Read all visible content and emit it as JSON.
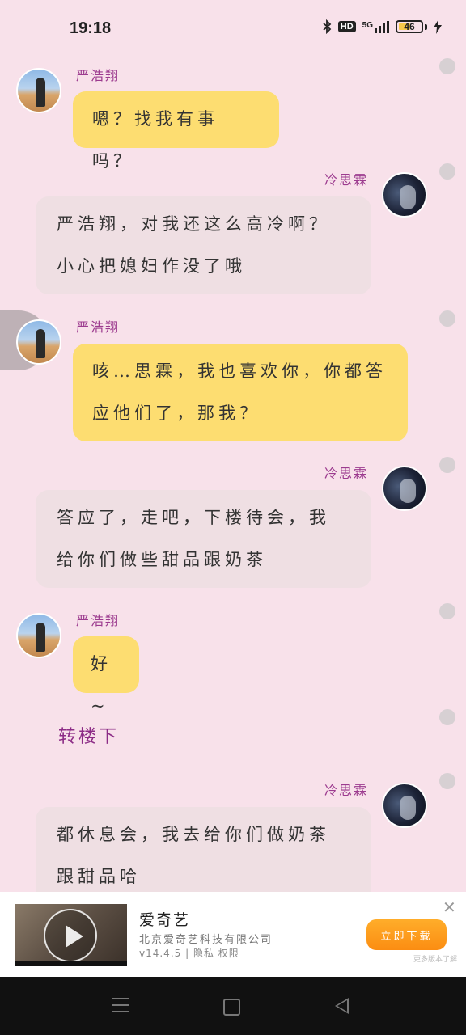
{
  "status_bar": {
    "time": "19:18",
    "hd_label": "HD",
    "network_label": "5G",
    "battery_level": "46"
  },
  "messages": [
    {
      "speaker": "严浩翔",
      "text": "嗯？找我有事吗？"
    },
    {
      "speaker": "冷思霖",
      "text": "严浩翔，对我还这么高冷啊？小心把媳妇作没了哦"
    },
    {
      "speaker": "严浩翔",
      "text": "咳…思霖，我也喜欢你，你都答应他们了，那我？"
    },
    {
      "speaker": "冷思霖",
      "text": "答应了，走吧，下楼待会，我给你们做些甜品跟奶茶"
    },
    {
      "speaker": "严浩翔",
      "text": "好~"
    },
    {
      "speaker": "冷思霖",
      "text": "都休息会，我去给你们做奶茶跟甜品哈"
    }
  ],
  "narration": "转楼下",
  "ad": {
    "title": "爱奇艺",
    "company": "北京爱奇艺科技有限公司",
    "meta": "v14.4.5 | 隐私 权限",
    "button_label": "立即下载",
    "close_label": "✕",
    "tag": "更多版本了解"
  }
}
